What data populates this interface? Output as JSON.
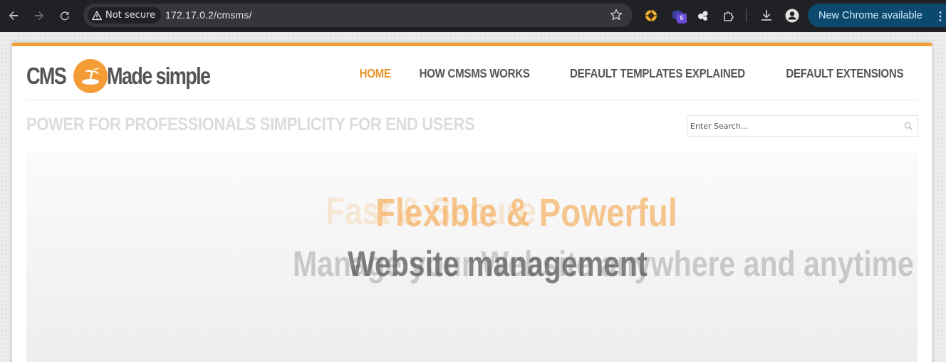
{
  "browser": {
    "security_label": "Not secure",
    "url": "172.17.0.2/cmsms/",
    "extension_badge": "6",
    "update_label": "New Chrome available"
  },
  "site": {
    "logo": {
      "left_word": "CMS",
      "right_word": "Made simple"
    },
    "nav": [
      {
        "label": "HOME",
        "active": true
      },
      {
        "label": "HOW CMSMS WORKS",
        "active": false
      },
      {
        "label": "DEFAULT TEMPLATES EXPLAINED",
        "active": false
      },
      {
        "label": "DEFAULT EXTENSIONS",
        "active": false
      }
    ],
    "tagline": "POWER FOR PROFESSIONALS SIMPLICITY FOR END USERS",
    "search": {
      "placeholder": "Enter Search..."
    },
    "banner": {
      "ghost_line1": "Fast & Secure",
      "line1": "Flexible & Powerful",
      "ghost_line2": "Manage your Website anywhere and anytime",
      "line2": "Website management"
    }
  },
  "colors": {
    "accent": "#f49d37",
    "nav_active": "#e8932e",
    "nav_text": "#555555",
    "toolbar": "#202124"
  }
}
